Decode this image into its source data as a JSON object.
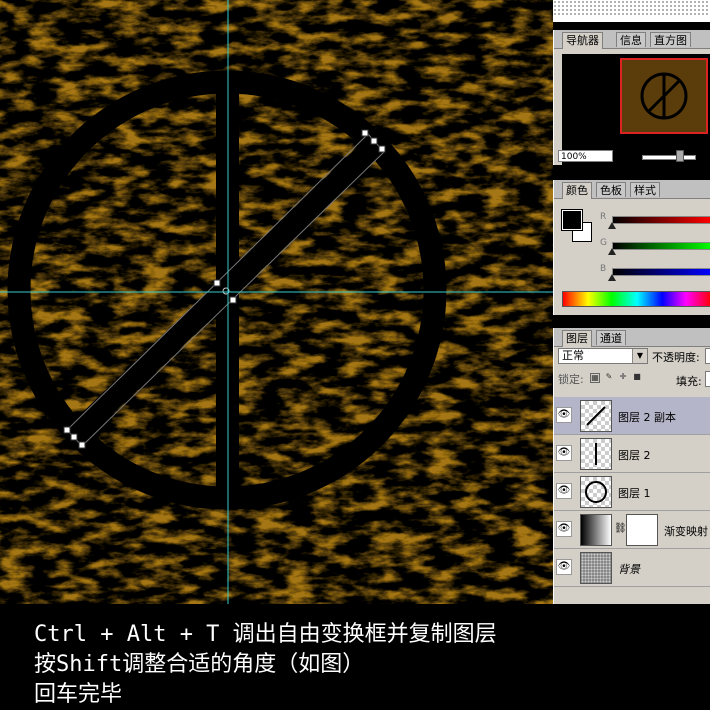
{
  "navigator_panel": {
    "tabs": [
      "导航器",
      "信息",
      "直方图"
    ],
    "active_tab": "导航器",
    "zoom": "100%"
  },
  "color_panel": {
    "tabs": [
      "颜色",
      "色板",
      "样式"
    ],
    "active_tab": "颜色",
    "channels": [
      {
        "label": "R",
        "color": "#ff0000"
      },
      {
        "label": "G",
        "color": "#00ff00"
      },
      {
        "label": "B",
        "color": "#0000ff"
      }
    ],
    "foreground": "#000000",
    "background": "#ffffff"
  },
  "layers_panel": {
    "tabs": [
      "图层",
      "通道"
    ],
    "active_tab": "图层",
    "blend_mode": "正常",
    "opacity_label": "不透明度:",
    "lock_label": "锁定:",
    "fill_label": "填充:",
    "layers": [
      {
        "name": "图层 2 副本",
        "selected": true,
        "thumb": "line-icon"
      },
      {
        "name": "图层 2",
        "selected": false,
        "thumb": "vline-icon"
      },
      {
        "name": "图层 1",
        "selected": false,
        "thumb": "ring-icon"
      },
      {
        "name": "渐变映射",
        "selected": false,
        "thumb": "gradient-map-icon"
      },
      {
        "name": "背景",
        "selected": false,
        "thumb": "texture-icon"
      }
    ]
  },
  "caption": {
    "line1": "Ctrl  + Alt + T 调出自由变换框并复制图层",
    "line2": "按Shift调整合适的角度（如图）",
    "line3": "回车完毕"
  },
  "colors": {
    "canvas_texture": "#a57612",
    "guide": "#33cccc",
    "symbol": "#000000"
  }
}
